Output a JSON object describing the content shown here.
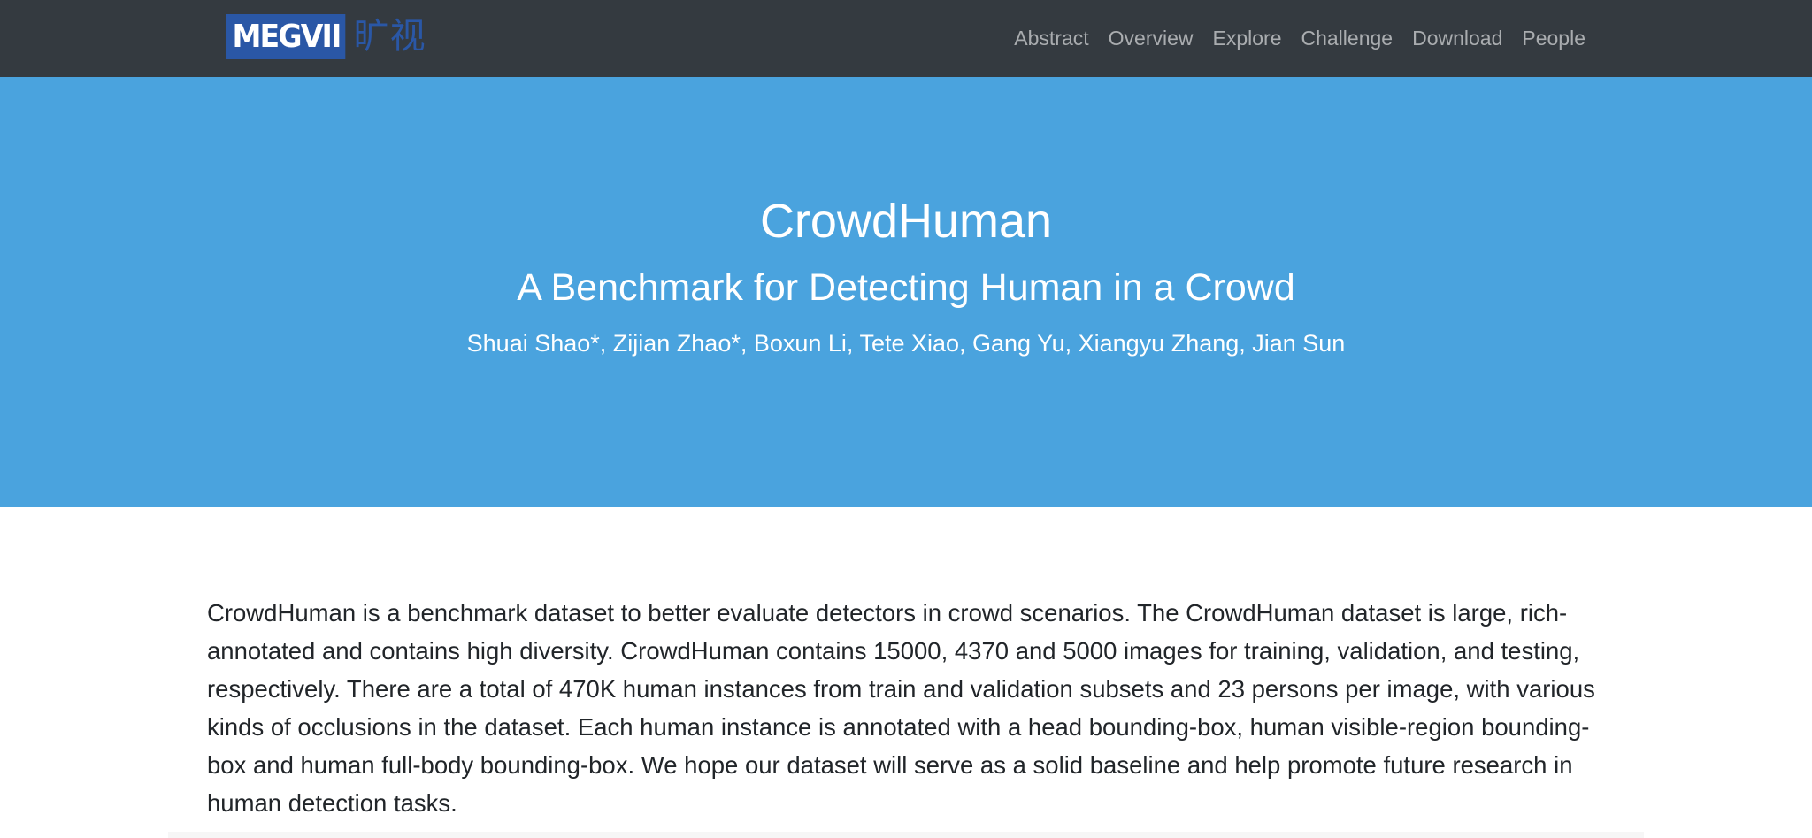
{
  "navbar": {
    "logo_text": "MEGVII",
    "logo_cn": "旷视",
    "links": [
      "Abstract",
      "Overview",
      "Explore",
      "Challenge",
      "Download",
      "People"
    ]
  },
  "hero": {
    "title": "CrowdHuman",
    "subtitle": "A Benchmark for Detecting Human in a Crowd",
    "authors": "Shuai Shao*, Zijian Zhao*, Boxun Li, Tete Xiao, Gang Yu, Xiangyu Zhang, Jian Sun"
  },
  "abstract": {
    "text": "CrowdHuman is a benchmark dataset to better evaluate detectors in crowd scenarios. The CrowdHuman dataset is large, rich-annotated and contains high diversity. CrowdHuman contains 15000, 4370 and 5000 images for training, validation, and testing, respectively. There are a total of 470K human instances from train and validation subsets and 23 persons per image, with various kinds of occlusions in the dataset. Each human instance is annotated with a head bounding-box, human visible-region bounding-box and human full-body bounding-box. We hope our dataset will serve as a solid baseline and help promote future research in human detection tasks."
  },
  "colors": {
    "navbar_bg": "#343a40",
    "hero_bg": "#4aa3de",
    "logo_blue": "#2a57a6"
  }
}
